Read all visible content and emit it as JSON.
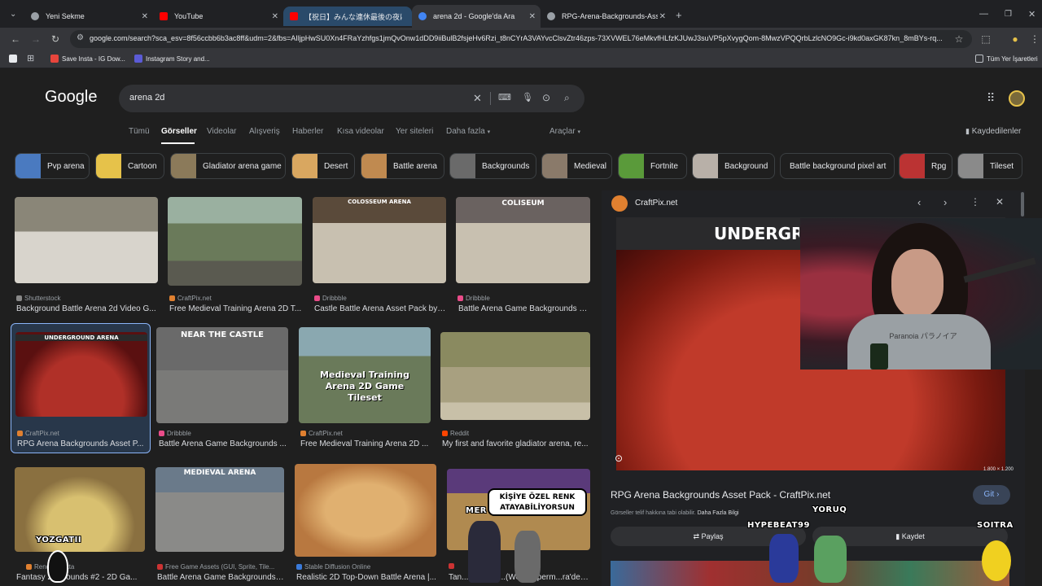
{
  "tabs": [
    {
      "title": "Yeni Sekme",
      "color": "#9aa0a6"
    },
    {
      "title": "YouTube",
      "color": "#ff0000"
    },
    {
      "title": "【祝日】みんな連休最後の夜は【お",
      "color": "#ff0000"
    },
    {
      "title": "arena 2d - Google'da Ara",
      "color": "#4285f4"
    },
    {
      "title": "RPG-Arena-Backgrounds-Asset",
      "color": "#9aa0a6"
    }
  ],
  "address": "google.com/search?sca_esv=8f56ccbb6b3ac8ff&udm=2&fbs=AIljpHwSU0Xn4FRaYzhfgs1jmQvOnw1dDD9iiBulB2fsjeHv6Rzi_t8nCYrA3VAYvcClsvZtr46zps-73XVWEL76eMkvfHLfzKJUwJ3suVP5pXvygQom-8MwzVPQQrbLzlcNO9Gc-i9kd0axGK87kn_8mBYs-rq...",
  "bookmarks": [
    {
      "label": "Save Insta - IG Dow...",
      "color": "#e8453c"
    },
    {
      "label": "Instagram Story and...",
      "color": "#5b5bd6"
    }
  ],
  "bookmarks_all": "Tüm Yer İşaretleri",
  "logo": "Google",
  "query": "arena 2d",
  "nav": [
    "Tümü",
    "Görseller",
    "Videolar",
    "Alışveriş",
    "Haberler",
    "Kısa videolar",
    "Yer siteleri",
    "Daha fazla"
  ],
  "tools": "Araçlar",
  "saved": "Kaydedilenler",
  "chips": [
    {
      "label": "Pvp arena",
      "color": "#4a7ac0"
    },
    {
      "label": "Cartoon",
      "color": "#e6c24a"
    },
    {
      "label": "Gladiator arena game",
      "color": "#8b7a5a"
    },
    {
      "label": "Desert",
      "color": "#d9a760"
    },
    {
      "label": "Battle arena",
      "color": "#c08a50"
    },
    {
      "label": "Backgrounds",
      "color": "#6a6a6a"
    },
    {
      "label": "Medieval",
      "color": "#8a7a6a"
    },
    {
      "label": "Fortnite",
      "color": "#5a9a3a"
    },
    {
      "label": "Background",
      "color": "#b8b0a8"
    },
    {
      "label": "Battle background pixel art",
      "color": ""
    },
    {
      "label": "Rpg",
      "color": "#b33"
    },
    {
      "label": "Tileset",
      "color": "#8a8a8a"
    }
  ],
  "results": [
    {
      "source": "Shutterstock",
      "title": "Background Battle Arena 2d Video G...",
      "caption": "",
      "color": "#d8d4cc",
      "fav": "#888"
    },
    {
      "source": "CraftPix.net",
      "title": "Free Medieval Training Arena 2D T...",
      "caption": "",
      "color": "#7a8a6a",
      "fav": "#e08030"
    },
    {
      "source": "Dribbble",
      "title": "Castle Battle Arena Asset Pack by ...",
      "caption": "COLOSSEUM ARENA",
      "color": "#c8c0b0",
      "fav": "#ea4c89"
    },
    {
      "source": "Dribbble",
      "title": "Battle Arena Game Backgrounds b...",
      "caption": "COLISEUM",
      "color": "#c8c0b0",
      "fav": "#ea4c89"
    },
    {
      "source": "CraftPix.net",
      "title": "RPG Arena Backgrounds Asset P...",
      "caption": "UNDERGROUND ARENA",
      "color": "#a02020",
      "fav": "#e08030"
    },
    {
      "source": "Dribbble",
      "title": "Battle Arena Game Backgrounds ...",
      "caption": "NEAR THE CASTLE",
      "color": "#7a7a78",
      "fav": "#ea4c89"
    },
    {
      "source": "CraftPix.net",
      "title": "Free Medieval Training Arena 2D ...",
      "caption": "Medieval Training Arena 2D Game Tileset",
      "color": "#6a7a5a",
      "fav": "#e08030"
    },
    {
      "source": "Reddit",
      "title": "My first and favorite gladiator arena, re...",
      "caption": "",
      "color": "#a8a080",
      "fav": "#ff4500"
    },
    {
      "source": "Render...lokta",
      "title": "Fantasy 2...grounds #2 - 2D Ga...",
      "caption": "",
      "color": "#b8a060",
      "fav": "#e08030"
    },
    {
      "source": "Free Game Assets (GUI, Sprite, Tile...",
      "title": "Battle Arena Game Backgrounds ...",
      "caption": "MEDIEVAL ARENA",
      "color": "#8a8a88",
      "fav": "#c33"
    },
    {
      "source": "Stable Diffusion Online",
      "title": "Realistic 2D Top-Down Battle Arena |...",
      "caption": "",
      "color": "#c89a60",
      "fav": "#3a7ad9"
    },
    {
      "source": "",
      "title": "Tan... Arena 2...(Web Superm...ra'den)...",
      "caption": "",
      "color": "#8a5aa0",
      "fav": "#c33"
    }
  ],
  "panel": {
    "site": "CraftPix.net",
    "image_caption": "UNDERGROUND ARENA",
    "dims": "1.800 × 1.200",
    "title": "RPG Arena Backgrounds Asset Pack - CraftPix.net",
    "go_label": "Git",
    "notice": "Görseller telif hakkına tabi olabilir.",
    "more_info": "Daha Fazla Bilgi",
    "share": "Paylaş",
    "save": "Kaydet"
  },
  "overlay": {
    "chat_badge": "KİŞİYE ÖZEL RENK ATAYABİLİYORSUN",
    "names": [
      "YOZGATII",
      "HYPEBEAT99",
      "YORUQ",
      "SOITRA",
      "MER"
    ],
    "shirt": "Paranoia パラノイア"
  }
}
